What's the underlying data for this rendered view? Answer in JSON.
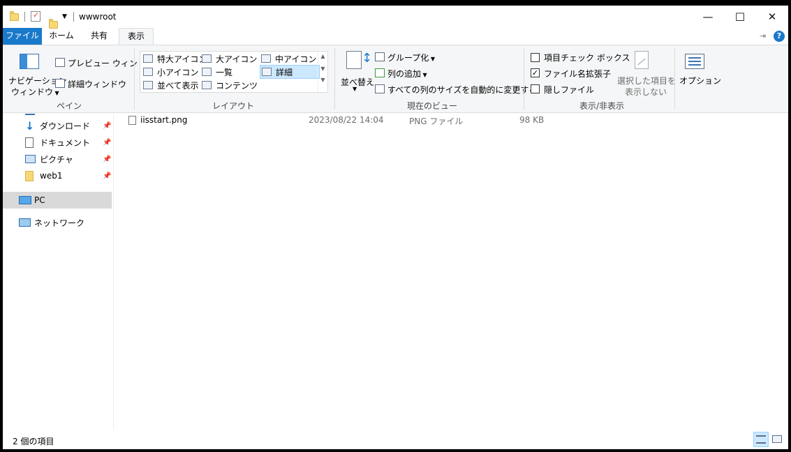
{
  "window": {
    "title": "wwwroot"
  },
  "caption": {
    "minimize": "—",
    "maximize": "☐",
    "close": "✕"
  },
  "tabs": {
    "file": "ファイル",
    "home": "ホーム",
    "share": "共有",
    "view": "表示"
  },
  "ribbon": {
    "pane": {
      "navigation_line1": "ナビゲーション",
      "navigation_line2": "ウィンドウ",
      "preview": "プレビュー ウィンドウ",
      "details": "詳細ウィンドウ",
      "label": "ペイン"
    },
    "layout": {
      "items": [
        "特大アイコン",
        "大アイコン",
        "中アイコン",
        "小アイコン",
        "一覧",
        "詳細",
        "並べて表示",
        "コンテンツ"
      ],
      "selected": "詳細",
      "label": "レイアウト"
    },
    "current_view": {
      "sort": "並べ替え",
      "group": "グループ化",
      "add_columns": "列の追加",
      "fit_columns": "すべての列のサイズを自動的に変更する",
      "label": "現在のビュー"
    },
    "show_hide": {
      "item_checkboxes": "項目チェック ボックス",
      "item_checkboxes_checked": false,
      "file_extensions": "ファイル名拡張子",
      "file_extensions_checked": true,
      "hidden_items": "隠しファイル",
      "hidden_items_checked": false,
      "hide_selected_line1": "選択した項目を",
      "hide_selected_line2": "表示しない",
      "label": "表示/非表示"
    },
    "options": "オプション"
  },
  "nav": {
    "items": [
      {
        "label": "ダウンロード",
        "icon": "download-arrow-icon",
        "pinned": true
      },
      {
        "label": "ドキュメント",
        "icon": "document-icon",
        "pinned": true
      },
      {
        "label": "ピクチャ",
        "icon": "picture-icon",
        "pinned": true
      },
      {
        "label": "web1",
        "icon": "folder-icon",
        "pinned": true
      },
      {
        "label": "PC",
        "icon": "pc-icon",
        "pinned": false
      },
      {
        "label": "ネットワーク",
        "icon": "network-icon",
        "pinned": false
      }
    ]
  },
  "files": [
    {
      "name": "iisstart.png",
      "date": "2023/08/22 14:04",
      "type": "PNG ファイル",
      "size": "98 KB"
    }
  ],
  "status": {
    "count": "2 個の項目"
  },
  "colors": {
    "accent": "#1979ca",
    "selection": "#cce8ff",
    "folder": "#f8d775"
  }
}
